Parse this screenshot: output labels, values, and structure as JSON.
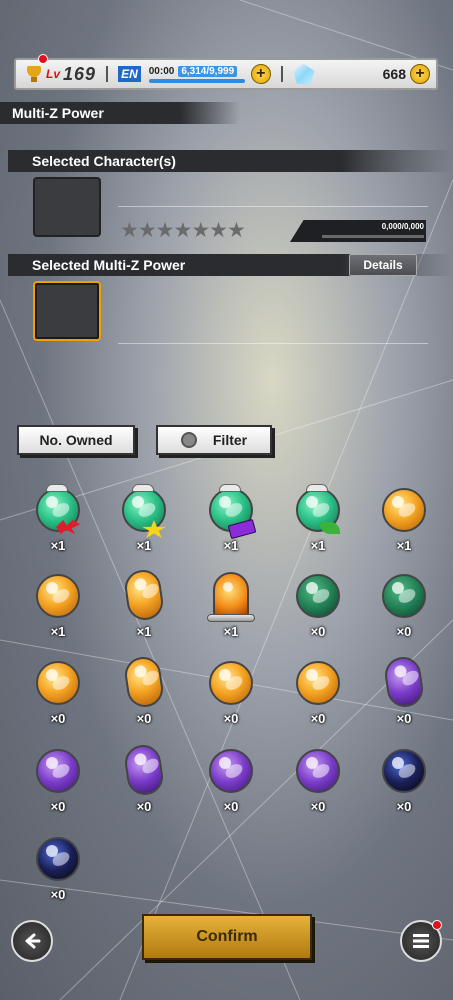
{
  "status_bar": {
    "level_tag": "Lv",
    "level": "169",
    "en_label": "EN",
    "en_time": "00:00",
    "en_value": "6,314/9,999",
    "gems": "668"
  },
  "header": {
    "title": "Multi-Z Power"
  },
  "selected_character": {
    "title": "Selected Character(s)",
    "stars": [
      "★",
      "★",
      "★",
      "★",
      "★",
      "★",
      "★"
    ],
    "xp": "0,000/0,000"
  },
  "selected_power": {
    "title": "Selected Multi-Z Power",
    "details_label": "Details"
  },
  "controls": {
    "sort_label": "No. Owned",
    "filter_label": "Filter"
  },
  "items": [
    {
      "count": "×1",
      "kind": "green",
      "badge": "red"
    },
    {
      "count": "×1",
      "kind": "green",
      "badge": "yellow"
    },
    {
      "count": "×1",
      "kind": "green",
      "badge": "purple"
    },
    {
      "count": "×1",
      "kind": "green",
      "badge": "green"
    },
    {
      "count": "×1",
      "kind": "orange",
      "badge": ""
    },
    {
      "count": "×1",
      "kind": "orange",
      "badge": ""
    },
    {
      "count": "×1",
      "kind": "orange-capsule",
      "badge": ""
    },
    {
      "count": "×1",
      "kind": "lamp",
      "badge": ""
    },
    {
      "count": "×0",
      "kind": "dgreen",
      "badge": ""
    },
    {
      "count": "×0",
      "kind": "dgreen",
      "badge": ""
    },
    {
      "count": "×0",
      "kind": "orange",
      "badge": ""
    },
    {
      "count": "×0",
      "kind": "orange-capsule",
      "badge": ""
    },
    {
      "count": "×0",
      "kind": "orange",
      "badge": ""
    },
    {
      "count": "×0",
      "kind": "orange",
      "badge": ""
    },
    {
      "count": "×0",
      "kind": "purple-capsule",
      "badge": ""
    },
    {
      "count": "×0",
      "kind": "purple",
      "badge": ""
    },
    {
      "count": "×0",
      "kind": "purple-capsule",
      "badge": ""
    },
    {
      "count": "×0",
      "kind": "purple",
      "badge": ""
    },
    {
      "count": "×0",
      "kind": "purple",
      "badge": ""
    },
    {
      "count": "×0",
      "kind": "dark",
      "badge": ""
    },
    {
      "count": "×0",
      "kind": "dark",
      "badge": ""
    }
  ],
  "footer": {
    "confirm_label": "Confirm",
    "back_icon": "arrow-left-icon",
    "menu_icon": "menu-icon"
  }
}
